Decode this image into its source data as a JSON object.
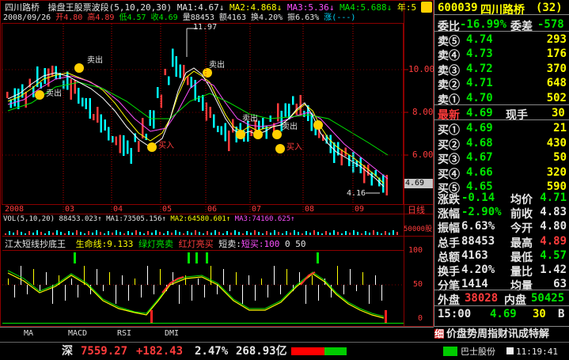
{
  "header": {
    "stock_name": "四川路桥",
    "indicator_name": "操盘王股票波段",
    "indicator_params": "(5,10,20,30)",
    "ma1": "MA1:4.67",
    "ma2": "MA2:4.868",
    "ma3": "MA3:5.36",
    "ma4": "MA4:5.688",
    "year": "年:5",
    "date": "2008/09/26",
    "open": "开4.80",
    "high": "高4.89",
    "low": "低4.57",
    "close": "收4.69",
    "volume": "量88453",
    "amount": "额4163",
    "turnover": "换4.20%",
    "amplitude": "振6.63%",
    "change": "涨(---)"
  },
  "price_chart": {
    "y_ticks": [
      "10.00",
      "8.00",
      "6.00"
    ],
    "high_marker": "11.97",
    "low_marker": "4.16",
    "current_price_tag": "4.69",
    "sell_labels": [
      "卖出",
      "卖出",
      "卖出",
      "卖出",
      "卖出"
    ],
    "buy_labels": [
      "买入",
      "买入"
    ],
    "x_labels": [
      "2008",
      "03",
      "04",
      "05",
      "06",
      "07",
      "08",
      "09"
    ],
    "x_axis_unit": "日线"
  },
  "volume_panel": {
    "title": "VOL(5,10,20)",
    "value": "88453.023",
    "ma1": "MA1:73505.156",
    "ma2": "MA2:64580.601",
    "ma3": "MA3:74160.625",
    "y_tick": "50000",
    "y_tick_unit": "股"
  },
  "indicator_panel": {
    "title": "江太短线抄底王",
    "lifeline": "生命线:9.133",
    "green_light": "绿灯亮卖",
    "red_light": "红灯亮买",
    "short_sell": "短卖:",
    "short_buy": "短买:100",
    "vals": "0 50",
    "y_ticks": [
      "100",
      "50",
      "0"
    ]
  },
  "tabs": [
    "MA",
    "MACD",
    "RSI",
    "DMI"
  ],
  "quote": {
    "code": "600039",
    "name": "四川路桥",
    "count": "(32)",
    "weibi_label": "委比",
    "weibi": "-16.99%",
    "weicha_label": "委差",
    "weicha": "-578",
    "sell": [
      {
        "label": "卖⑤",
        "price": "4.74",
        "vol": "293"
      },
      {
        "label": "卖④",
        "price": "4.73",
        "vol": "176"
      },
      {
        "label": "卖③",
        "price": "4.72",
        "vol": "370"
      },
      {
        "label": "卖②",
        "price": "4.71",
        "vol": "648"
      },
      {
        "label": "卖①",
        "price": "4.70",
        "vol": "502"
      }
    ],
    "latest_label": "最新",
    "latest": "4.69",
    "now_hand_label": "现手",
    "now_hand": "30",
    "buy": [
      {
        "label": "买①",
        "price": "4.69",
        "vol": "21"
      },
      {
        "label": "买②",
        "price": "4.68",
        "vol": "430"
      },
      {
        "label": "买③",
        "price": "4.67",
        "vol": "50"
      },
      {
        "label": "买④",
        "price": "4.66",
        "vol": "320"
      },
      {
        "label": "买⑤",
        "price": "4.65",
        "vol": "590"
      }
    ],
    "stats": [
      [
        "涨跌",
        "-0.14",
        "均价",
        "4.71"
      ],
      [
        "涨幅",
        "-2.90%",
        "前收",
        "4.83"
      ],
      [
        "振幅",
        "6.63%",
        "今开",
        "4.80"
      ],
      [
        "总手",
        "88453",
        "最高",
        "4.89"
      ],
      [
        "总额",
        "4163",
        "最低",
        "4.57"
      ],
      [
        "换手",
        "4.20%",
        "量比",
        "1.42"
      ],
      [
        "分笔",
        "1414",
        "均量",
        "63"
      ]
    ],
    "outer_label": "外盘",
    "outer": "38028",
    "inner_label": "内盘",
    "inner": "50425",
    "tick_time": "15:00",
    "tick_price": "4.69",
    "tick_vol": "30",
    "tick_dir": "B",
    "bottom_tabs": "价盘势周指财讯成特解",
    "tool_label": "细"
  },
  "status": {
    "index_name": "深",
    "index_value": "7559.27",
    "index_change": "+182.43",
    "index_pct": "2.47%",
    "index_amount": "268.93亿",
    "ticker": "巴士股份",
    "time": "11:19:41"
  },
  "colors": {
    "up": "#ff3c3c",
    "down": "#00ffff",
    "ma_white": "#ffffff",
    "ma_yellow": "#ffff00",
    "ma_magenta": "#ff50ff",
    "ma_green": "#00e600"
  }
}
